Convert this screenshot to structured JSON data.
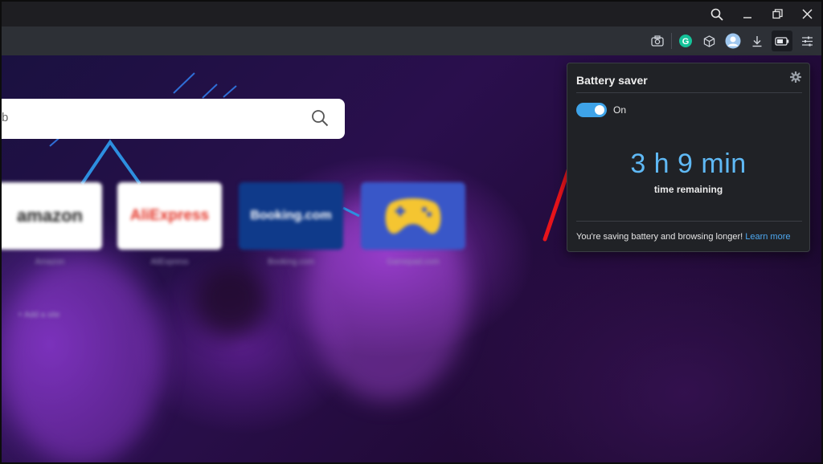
{
  "window": {
    "controls": [
      {
        "name": "search-icon"
      },
      {
        "name": "minimize-icon"
      },
      {
        "name": "restore-icon"
      },
      {
        "name": "close-icon"
      }
    ]
  },
  "toolbar": {
    "icons": [
      "camera-icon",
      "grammarly-icon",
      "cube-icon",
      "profile-icon",
      "download-icon",
      "battery-icon",
      "settings-sliders-icon"
    ],
    "grammarly_letter": "G",
    "accent_color": "#3ea3e8"
  },
  "search": {
    "text": "b"
  },
  "speed_dials": [
    {
      "title": "amazon",
      "label": "Amazon",
      "bg": "#ffffff",
      "fg": "#222222"
    },
    {
      "title": "AliExpress",
      "label": "AliExpress",
      "bg": "#ffffff",
      "fg": "#e43225"
    },
    {
      "title": "Booking.com",
      "label": "Booking.com",
      "bg": "#0f3a8a",
      "fg": "#ffffff"
    },
    {
      "title": "",
      "label": "Gamepad.com",
      "bg": "#3957c8",
      "fg": "#f5c531"
    }
  ],
  "add_site": "+ Add a site",
  "battery_popup": {
    "title": "Battery saver",
    "toggle_label": "On",
    "toggle_state": true,
    "time_value": "3 h 9 min",
    "time_caption": "time remaining",
    "footer_text": "You're saving battery and browsing longer!",
    "footer_link": "Learn more"
  }
}
